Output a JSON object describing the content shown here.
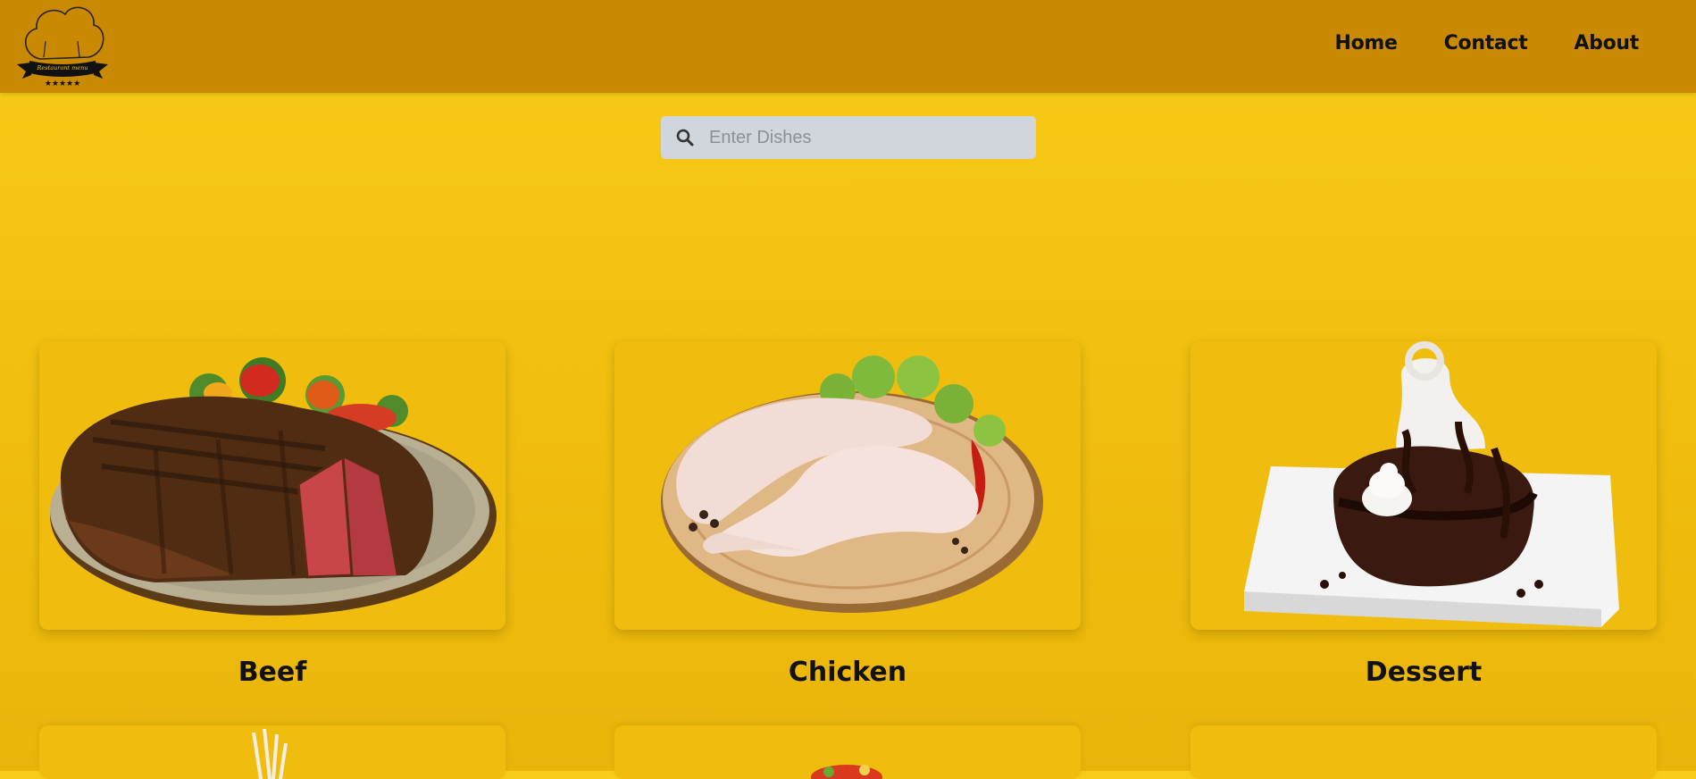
{
  "navbar": {
    "logo_text": "Restaurant menu",
    "links": [
      "Home",
      "Contact",
      "About"
    ]
  },
  "search": {
    "placeholder": "Enter Dishes",
    "value": ""
  },
  "categories": [
    {
      "label": "Beef"
    },
    {
      "label": "Chicken"
    },
    {
      "label": "Dessert"
    }
  ],
  "colors": {
    "navbar_bg": "#c98a01",
    "page_bg": "#f5c514",
    "search_bg": "#d1d5dc"
  }
}
